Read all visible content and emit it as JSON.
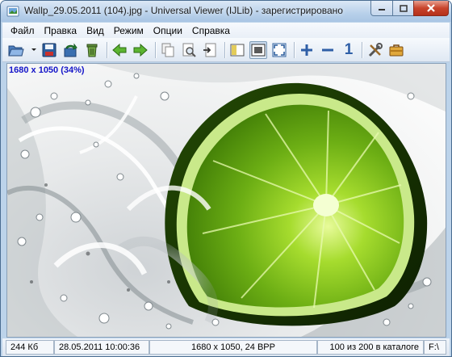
{
  "window": {
    "title": "Wallp_29.05.2011 (104).jpg - Universal Viewer (IJLib) - зарегистрировано"
  },
  "menu": [
    "Файл",
    "Правка",
    "Вид",
    "Режим",
    "Опции",
    "Справка"
  ],
  "toolbar": {
    "buttons": [
      "open-folder-icon",
      "save-icon",
      "reload-icon",
      "delete-icon",
      "previous-arrow-icon",
      "next-arrow-icon",
      "copy-icon",
      "preview-icon",
      "export-icon",
      "sidebar-panel-icon",
      "fit-window-icon",
      "fullscreen-icon",
      "zoom-in-icon",
      "zoom-out-icon",
      "actual-size-icon",
      "tools-icon",
      "toolbox-icon"
    ],
    "actual_size_label": "1"
  },
  "viewer": {
    "image_info": "1680 x 1050 (34%)",
    "image_subject": "lime-in-water-splash"
  },
  "status": {
    "size": "244 Кб",
    "datetime": "28.05.2011 10:00:36",
    "dimensions": "1680 x 1050, 24 BPP",
    "position": "100 из 200 в каталоге",
    "extra": "F:\\"
  },
  "colors": {
    "lime": "#7fc31c",
    "lime_dark": "#2f5a05",
    "info_text": "#1515c8",
    "close_button": "#c8442c"
  }
}
